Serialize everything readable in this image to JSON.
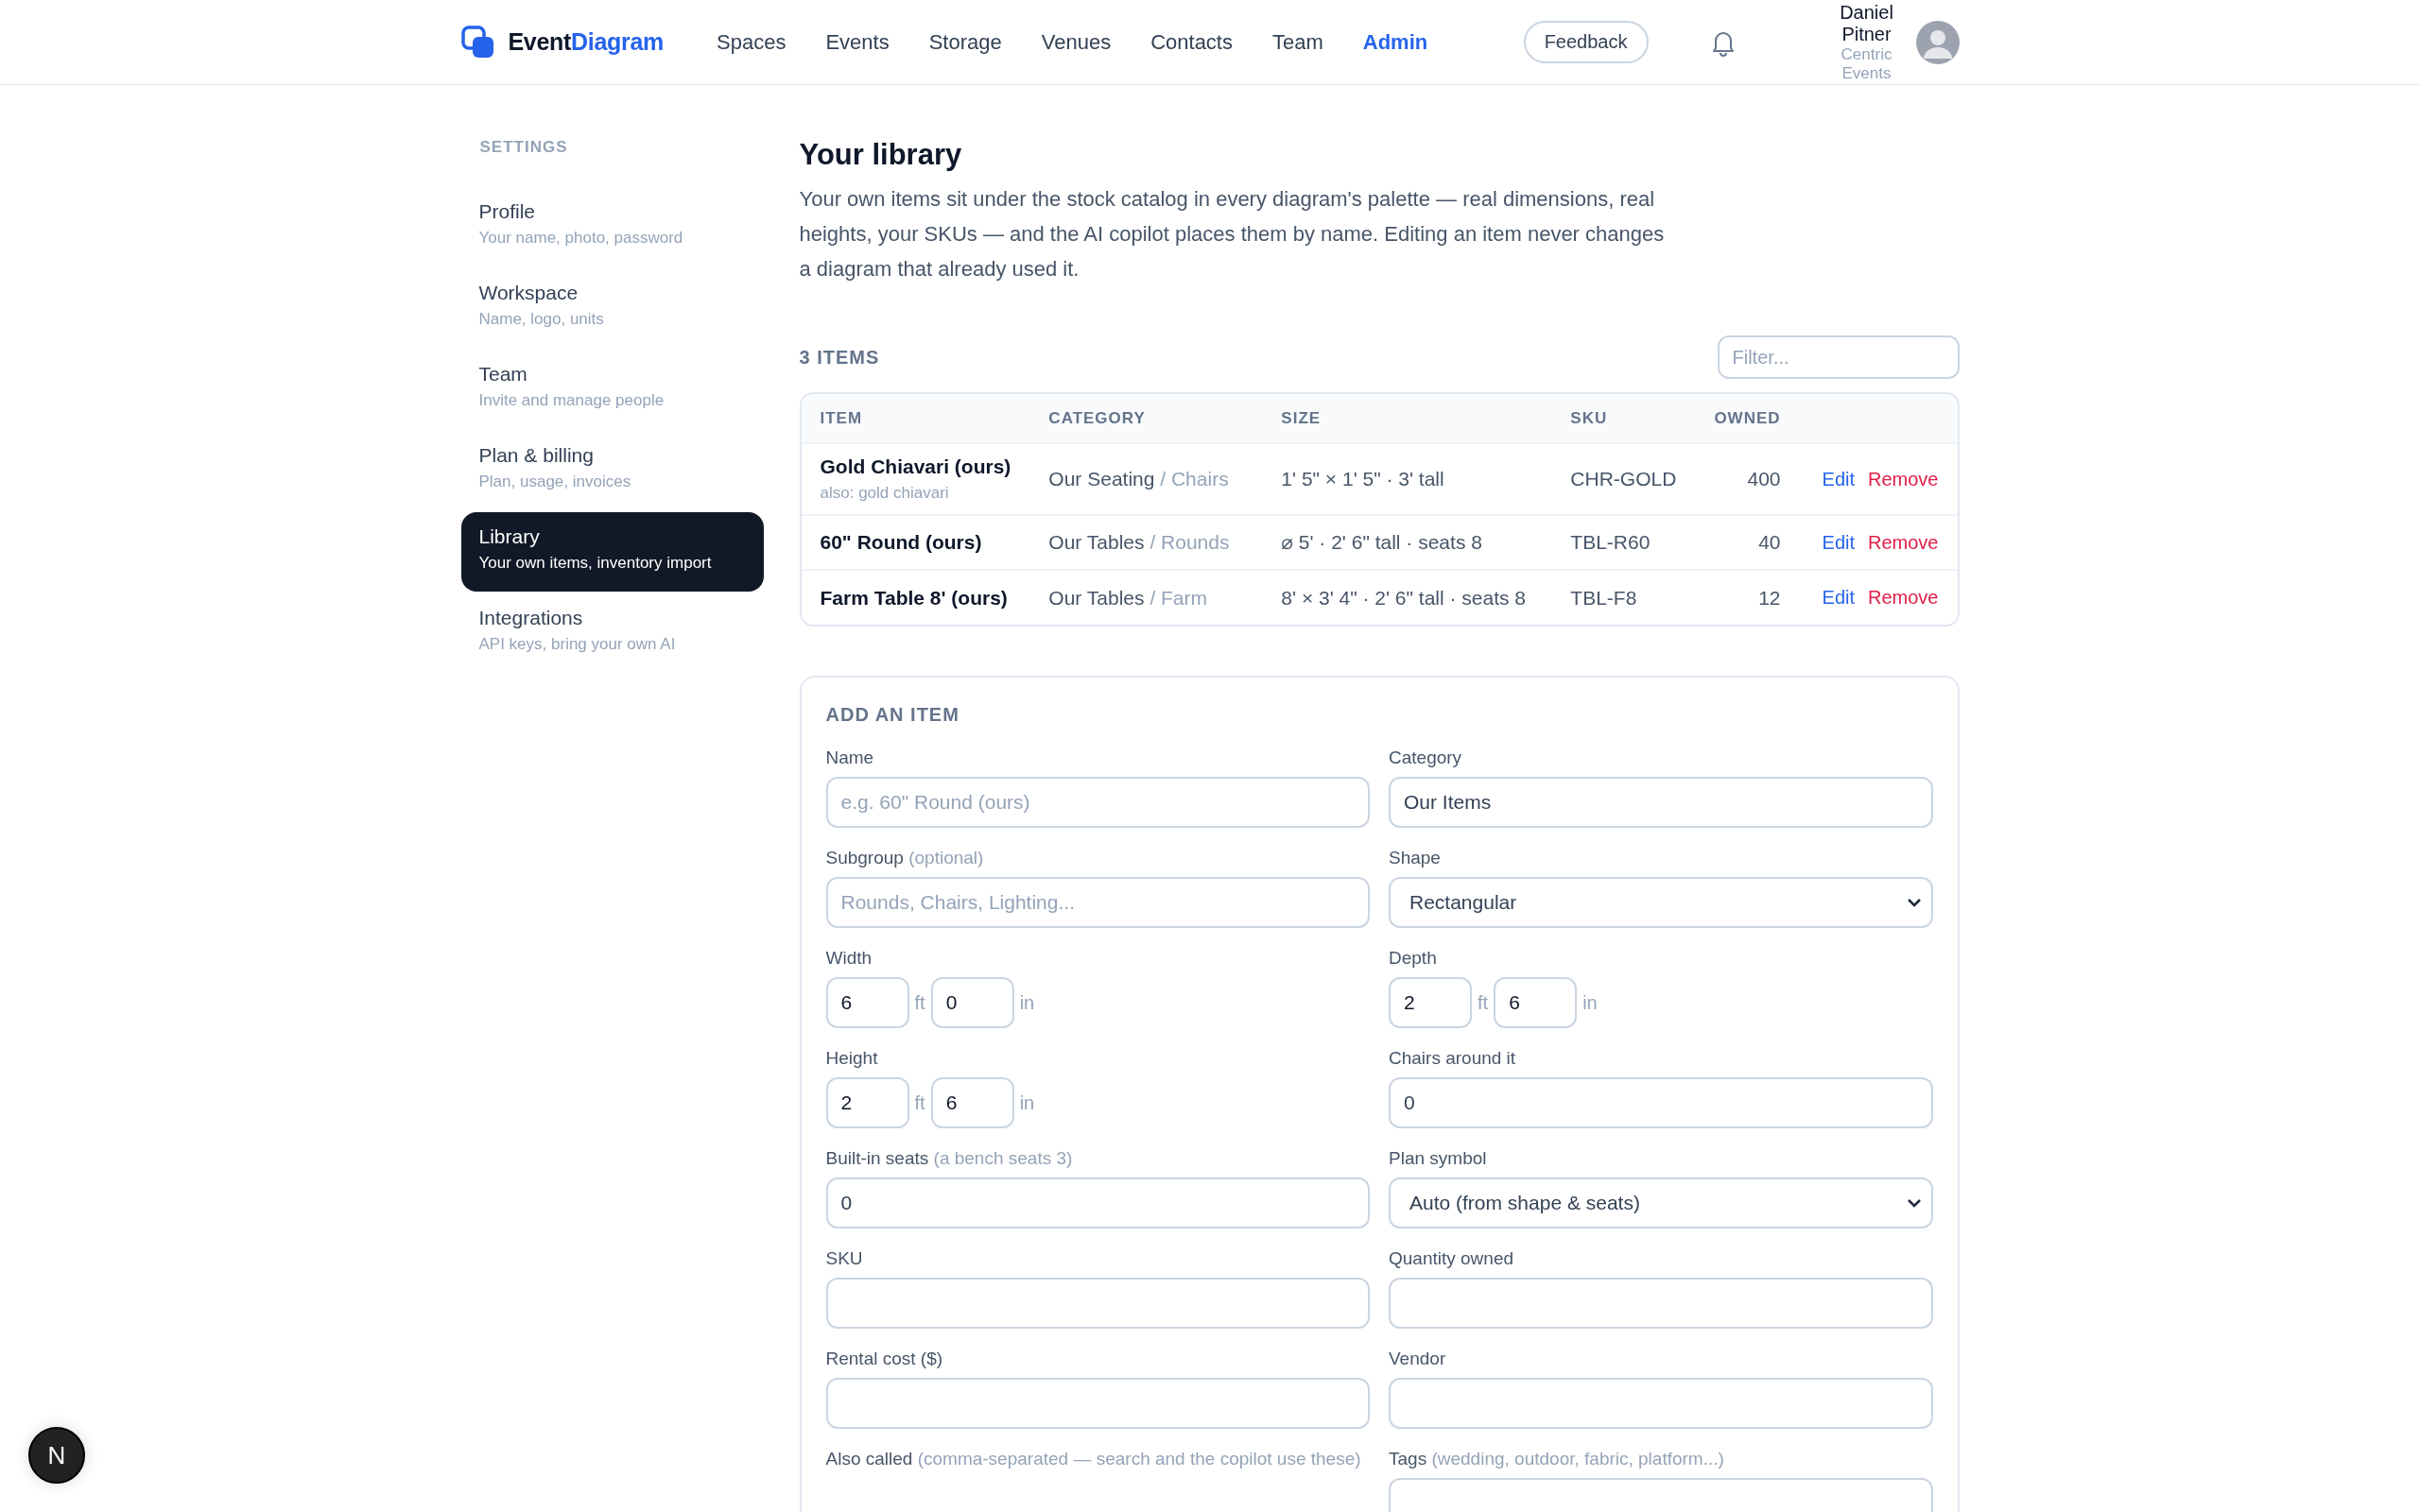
{
  "brand": {
    "text_main": "Event",
    "text_accent": "Diagram"
  },
  "nav": [
    {
      "label": "Spaces",
      "selected": false
    },
    {
      "label": "Events",
      "selected": false
    },
    {
      "label": "Storage",
      "selected": false
    },
    {
      "label": "Venues",
      "selected": false
    },
    {
      "label": "Contacts",
      "selected": false
    },
    {
      "label": "Team",
      "selected": false
    },
    {
      "label": "Admin",
      "selected": true
    }
  ],
  "feedback_button": "Feedback",
  "user": {
    "name": "Daniel Pitner",
    "org": "Centric Events"
  },
  "sidebar": {
    "heading": "SETTINGS",
    "items": [
      {
        "title": "Profile",
        "subtitle": "Your name, photo, password",
        "selected": false
      },
      {
        "title": "Workspace",
        "subtitle": "Name, logo, units",
        "selected": false
      },
      {
        "title": "Team",
        "subtitle": "Invite and manage people",
        "selected": false
      },
      {
        "title": "Plan & billing",
        "subtitle": "Plan, usage, invoices",
        "selected": false
      },
      {
        "title": "Library",
        "subtitle": "Your own items, inventory import",
        "selected": true
      },
      {
        "title": "Integrations",
        "subtitle": "API keys, bring your own AI",
        "selected": false
      }
    ]
  },
  "page": {
    "title": "Your library",
    "intro": "Your own items sit under the stock catalog in every diagram's palette — real dimensions, real heights, your SKUs — and the AI copilot places them by name. Editing an item never changes a diagram that already used it."
  },
  "items_bar": {
    "count": "3 ITEMS",
    "filter_placeholder": "Filter..."
  },
  "table": {
    "columns": [
      "ITEM",
      "CATEGORY",
      "SIZE",
      "SKU",
      "OWNED"
    ],
    "rows": [
      {
        "item": "Gold Chiavari (ours)",
        "alias": "also: gold chiavari",
        "category": "Our Seating",
        "subgroup": "/ Chairs",
        "size": "1' 5\" × 1' 5\" · 3' tall",
        "sku": "CHR-GOLD",
        "owned": "400",
        "edit": "Edit",
        "remove": "Remove"
      },
      {
        "item": "60\" Round (ours)",
        "category": "Our Tables",
        "subgroup": "/ Rounds",
        "size": "⌀ 5' · 2' 6\" tall · seats 8",
        "sku": "TBL-R60",
        "owned": "40",
        "edit": "Edit",
        "remove": "Remove"
      },
      {
        "item": "Farm Table 8' (ours)",
        "category": "Our Tables",
        "subgroup": "/ Farm",
        "size": "8' × 3' 4\" · 2' 6\" tall · seats 8",
        "sku": "TBL-F8",
        "owned": "12",
        "edit": "Edit",
        "remove": "Remove"
      }
    ]
  },
  "form": {
    "title": "ADD AN ITEM",
    "fields": [
      {
        "kind": "text",
        "label": "Name",
        "placeholder": "e.g. 60\" Round (ours)"
      },
      {
        "kind": "text",
        "label": "Category",
        "value": "Our Items"
      },
      {
        "kind": "text",
        "label": "Subgroup",
        "hint": "(optional)",
        "placeholder": "Rounds, Chairs, Lighting..."
      },
      {
        "kind": "select",
        "label": "Shape",
        "value": "Rectangular"
      },
      {
        "kind": "dims",
        "label": "Width",
        "feet": "6",
        "feet_unit": "ft",
        "inches": "0",
        "inch_unit": "in"
      },
      {
        "kind": "dims",
        "label": "Depth",
        "feet": "2",
        "feet_unit": "ft",
        "inches": "6",
        "inch_unit": "in"
      },
      {
        "kind": "dims",
        "label": "Height",
        "feet": "2",
        "feet_unit": "ft",
        "inches": "6",
        "inch_unit": "in"
      },
      {
        "kind": "text",
        "label": "Chairs around it",
        "value": "0"
      },
      {
        "kind": "text",
        "label": "Built-in seats",
        "hint": "(a bench seats 3)",
        "value": "0"
      },
      {
        "kind": "select",
        "label": "Plan symbol",
        "value": "Auto (from shape & seats)"
      },
      {
        "kind": "text",
        "label": "SKU"
      },
      {
        "kind": "text",
        "label": "Quantity owned"
      },
      {
        "kind": "text",
        "label": "Rental cost ($)"
      },
      {
        "kind": "text",
        "label": "Vendor"
      },
      {
        "kind": "label",
        "label": "Also called",
        "hint": "(comma-separated — search and the copilot use these)"
      },
      {
        "kind": "text",
        "label": "Tags",
        "hint": "(wedding, outdoor, fabric, platform...)"
      }
    ]
  },
  "dev_badge": "N"
}
